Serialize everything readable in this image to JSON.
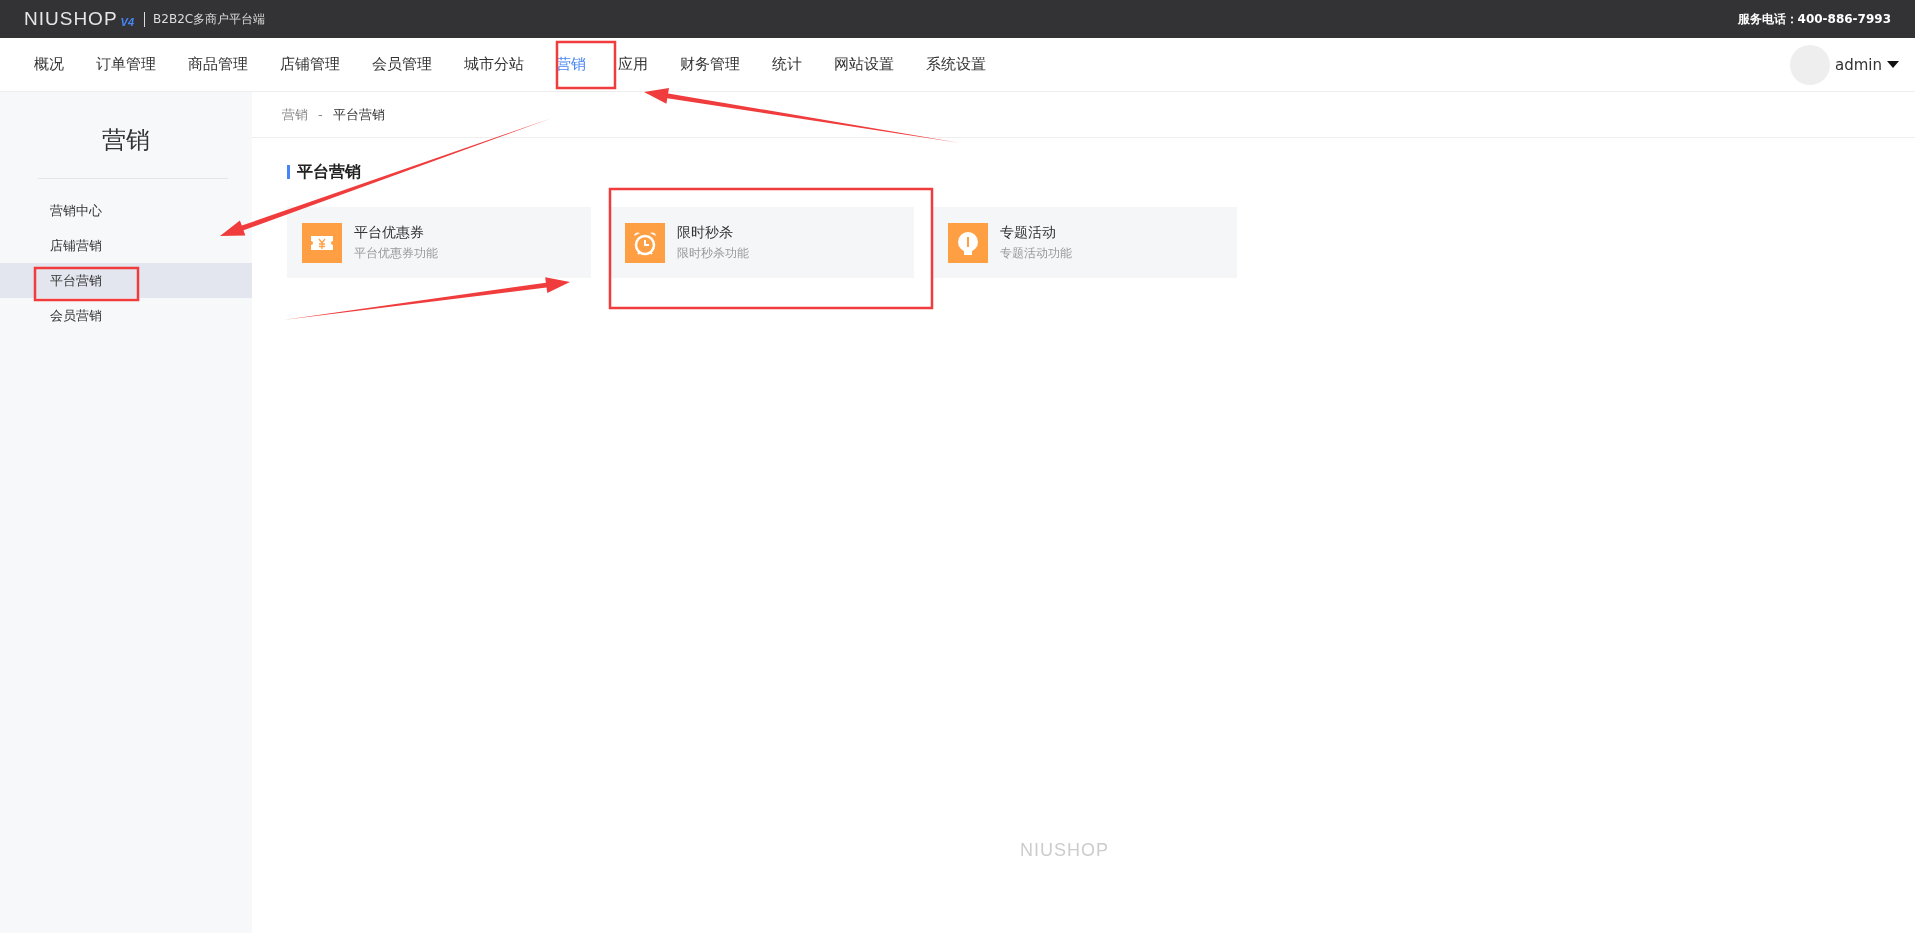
{
  "header": {
    "brand": "NIUSHOP",
    "version": "V4",
    "subtitle": "B2B2C多商户平台端",
    "hotline": "服务电话：400-886-7993"
  },
  "nav": {
    "items": [
      {
        "label": "概况",
        "selected": false
      },
      {
        "label": "订单管理",
        "selected": false
      },
      {
        "label": "商品管理",
        "selected": false
      },
      {
        "label": "店铺管理",
        "selected": false
      },
      {
        "label": "会员管理",
        "selected": false
      },
      {
        "label": "城市分站",
        "selected": false
      },
      {
        "label": "营销",
        "selected": true
      },
      {
        "label": "应用",
        "selected": false
      },
      {
        "label": "财务管理",
        "selected": false
      },
      {
        "label": "统计",
        "selected": false
      },
      {
        "label": "网站设置",
        "selected": false
      },
      {
        "label": "系统设置",
        "selected": false
      }
    ],
    "user": "admin"
  },
  "sidebar": {
    "title": "营销",
    "items": [
      {
        "label": "营销中心",
        "selected": false
      },
      {
        "label": "店铺营销",
        "selected": false
      },
      {
        "label": "平台营销",
        "selected": true
      },
      {
        "label": "会员营销",
        "selected": false
      }
    ]
  },
  "breadcrumb": [
    "营销",
    "-",
    "平台营销"
  ],
  "section": {
    "title": "平台营销",
    "cards": [
      {
        "kind": "coupon",
        "title": "平台优惠券",
        "desc": "平台优惠券功能"
      },
      {
        "kind": "clock",
        "title": "限时秒杀",
        "desc": "限时秒杀功能"
      },
      {
        "kind": "bulb",
        "title": "专题活动",
        "desc": "专题活动功能"
      }
    ]
  },
  "footer": {
    "brand": "NIUSHOP"
  }
}
